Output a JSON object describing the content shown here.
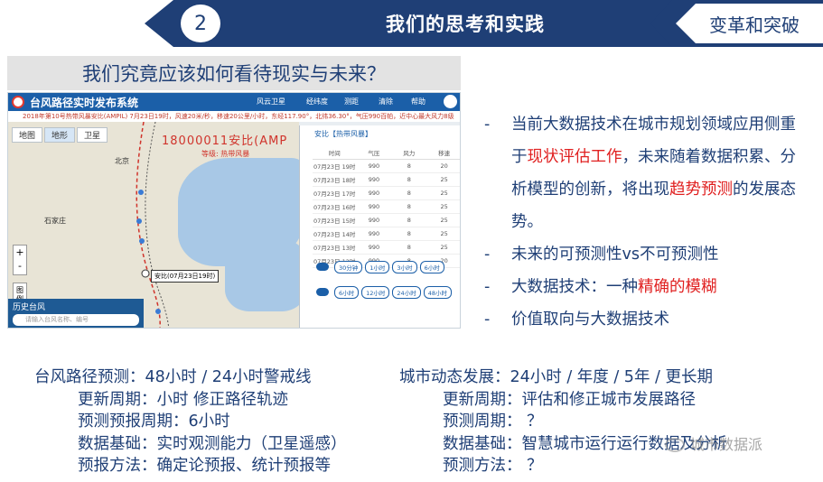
{
  "header": {
    "section_number": "2",
    "title": "我们的思考和实践",
    "right_label": "变革和突破"
  },
  "question": "我们究竟应该如何看待现实与未来？",
  "screenshot": {
    "app_title": "台风路径实时发布系统",
    "nav": [
      "风云卫星",
      "经纬度",
      "测距",
      "清除",
      "帮助"
    ],
    "subtitle": "2018年第10号热带风暴安比(AMPIL)  7月23日19时，风速20米/秒，移速20公里/小时，东经117.90°，北纬36.30°，气压990百帕，近中心最大风力8级",
    "map_tabs": [
      "地图",
      "地形",
      "卫星"
    ],
    "zoom_in": "+",
    "zoom_out": "-",
    "legend_btn": "图例",
    "storm_name": "18000011安比(AMP",
    "storm_level": "等级: 热带风暴",
    "cities": [
      "北京",
      "石家庄"
    ],
    "track_label": "安比(07月23日19时)",
    "history_title": "历史台风",
    "history_placeholder": "请输入台风名称、编号",
    "panel_title": "安比【热带风暴】",
    "table_headers": [
      "时间",
      "气压",
      "风力",
      "移速"
    ],
    "table_rows": [
      [
        "07月23日 19时",
        "990",
        "8",
        "20"
      ],
      [
        "07月23日 18时",
        "990",
        "8",
        "25"
      ],
      [
        "07月23日 17时",
        "990",
        "8",
        "25"
      ],
      [
        "07月23日 16时",
        "990",
        "8",
        "25"
      ],
      [
        "07月23日 15时",
        "990",
        "8",
        "25"
      ],
      [
        "07月23日 14时",
        "990",
        "8",
        "25"
      ],
      [
        "07月23日 13时",
        "990",
        "8",
        "25"
      ],
      [
        "07月23日 12时",
        "990",
        "8",
        "20"
      ]
    ],
    "btn_row1": [
      "30分钟",
      "1小时",
      "3小时",
      "6小时"
    ],
    "btn_row2": [
      "6小时",
      "12小时",
      "24小时",
      "48小时"
    ]
  },
  "bullets": [
    {
      "before": "当前大数据技术在城市规划领域应用侧重于",
      "highlight": "现状评估工作",
      "after": "，未来随着数据积累、分析模型的创新，将出现",
      "highlight2": "趋势预测",
      "after2": "的发展态势。"
    },
    {
      "text": "未来的可预测性vs不可预测性"
    },
    {
      "before": "大数据技术：一种",
      "highlight": "精确的模糊"
    },
    {
      "text": "价值取向与大数据技术"
    }
  ],
  "left_column": [
    "台风路径预测：48小时 / 24小时警戒线",
    "更新周期：小时  修正路径轨迹",
    "预测预报周期：6小时",
    "数据基础：实时观测能力（卫星遥感）",
    "预报方法：确定论预报、统计预报等"
  ],
  "right_column": [
    "城市动态发展：24小时 / 年度 / 5年 / 更长期",
    "更新周期：评估和修正城市发展路径",
    "预测周期： ？",
    "数据基础：智慧城市运行运行数据及分析",
    "预测方法： ？"
  ],
  "watermark": "城市数据派",
  "colors": {
    "navy": "#1f3f76",
    "accent_red": "#e02020",
    "app_blue": "#1b5fa8"
  }
}
